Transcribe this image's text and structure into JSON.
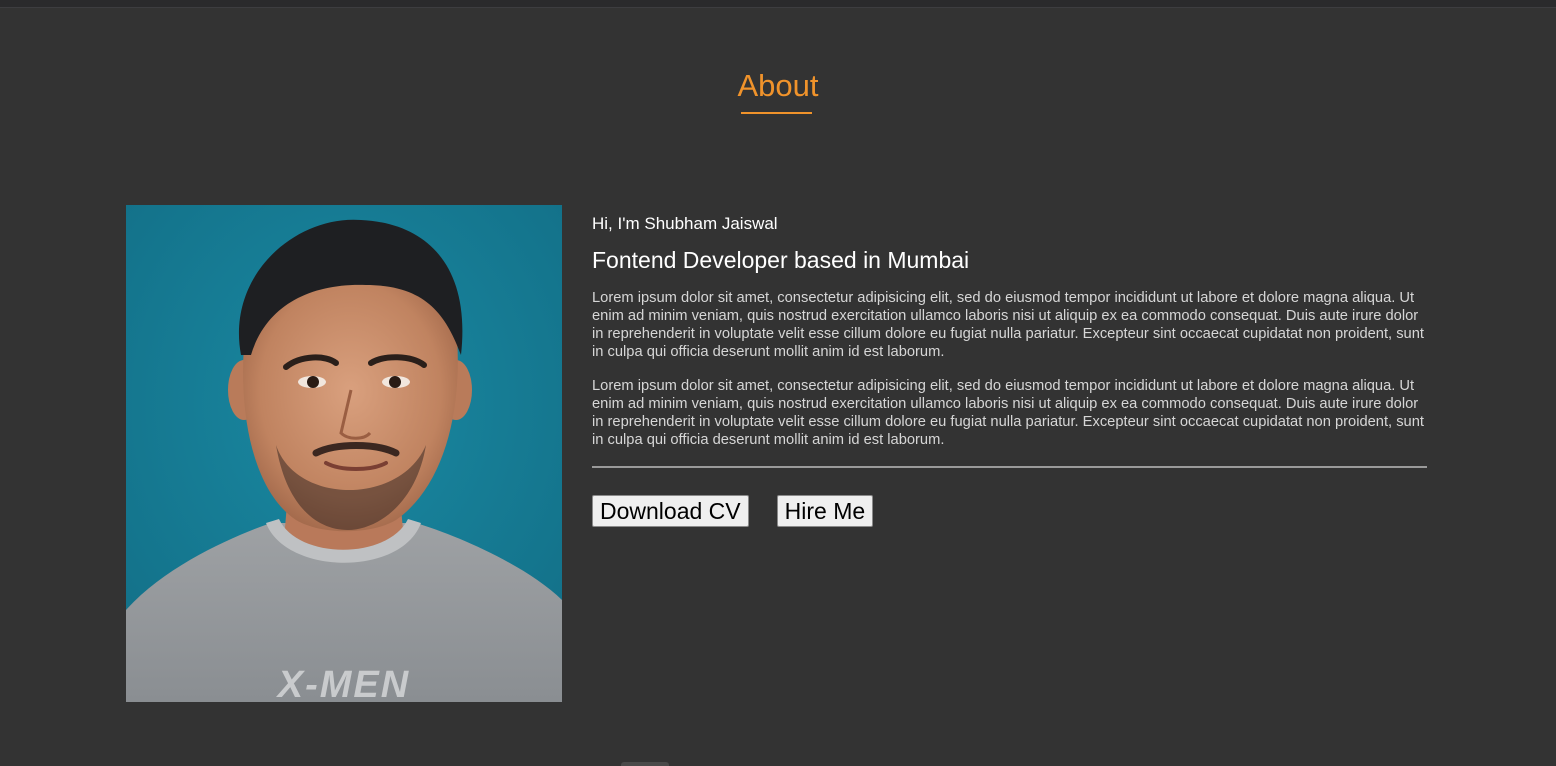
{
  "section": {
    "title": "About"
  },
  "about": {
    "greeting": "Hi, I'm Shubham Jaiswal",
    "role": "Fontend Developer based in Mumbai",
    "paragraphs": [
      "Lorem ipsum dolor sit amet, consectetur adipisicing elit, sed do eiusmod tempor incididunt ut labore et dolore magna aliqua. Ut enim ad minim veniam, quis nostrud exercitation ullamco laboris nisi ut aliquip ex ea commodo consequat. Duis aute irure dolor in reprehenderit in voluptate velit esse cillum dolore eu fugiat nulla pariatur. Excepteur sint occaecat cupidatat non proident, sunt in culpa qui officia deserunt mollit anim id est laborum.",
      "Lorem ipsum dolor sit amet, consectetur adipisicing elit, sed do eiusmod tempor incididunt ut labore et dolore magna aliqua. Ut enim ad minim veniam, quis nostrud exercitation ullamco laboris nisi ut aliquip ex ea commodo consequat. Duis aute irure dolor in reprehenderit in voluptate velit esse cillum dolore eu fugiat nulla pariatur. Excepteur sint occaecat cupidatat non proident, sunt in culpa qui officia deserunt mollit anim id est laborum."
    ],
    "photo": {
      "shirt_text": "X-MEN"
    }
  },
  "actions": {
    "download_cv_label": "Download CV",
    "hire_me_label": "Hire Me"
  },
  "colors": {
    "page_background": "#333333",
    "accent": "#f0932b",
    "photo_background": "#177c94"
  }
}
